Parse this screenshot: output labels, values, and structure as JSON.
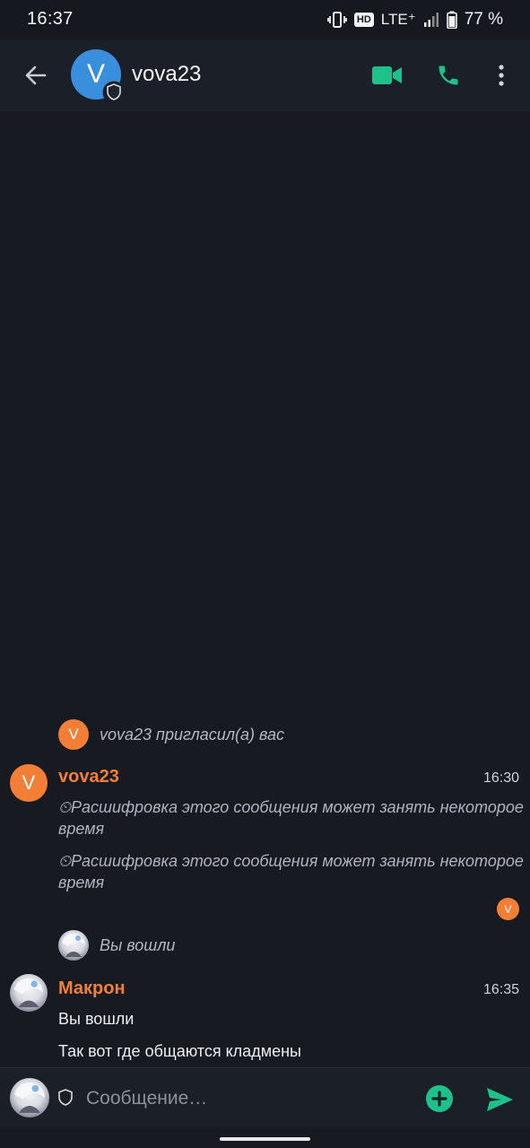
{
  "status_bar": {
    "time": "16:37",
    "hd": "HD",
    "network": "LTE⁺",
    "battery": "77 %",
    "icons": [
      "vibrate-icon",
      "signal-icon",
      "battery-icon"
    ]
  },
  "header": {
    "title": "vova23",
    "avatar_letter": "V",
    "avatar_color": "#3a8fdd",
    "icons": [
      "back-arrow-icon",
      "shield-icon",
      "video-call-icon",
      "phone-icon",
      "more-vert-icon"
    ],
    "accent_color": "#1fc18a"
  },
  "timeline": {
    "invite": {
      "avatar_letter": "V",
      "text": "vova23 пригласил(а) вас"
    },
    "group1": {
      "sender": "vova23",
      "avatar_letter": "V",
      "time": "16:30",
      "messages": [
        "⏲Расшифровка этого сообщения может занять некоторое время",
        "⏲Расшифровка этого сообщения может занять некоторое время"
      ],
      "read_receipt_letter": "V"
    },
    "joined": {
      "text": "Вы вошли"
    },
    "group2": {
      "sender": "Макрон",
      "time": "16:35",
      "messages": [
        "Вы вошли",
        "Так вот где общаются кладмены"
      ]
    }
  },
  "composer": {
    "placeholder": "Сообщение…",
    "icons": [
      "shield-icon",
      "add-circle-icon",
      "send-icon"
    ]
  },
  "colors": {
    "background": "#171a21",
    "sender_name": "#f37f36",
    "accent_green": "#1fc18a"
  }
}
